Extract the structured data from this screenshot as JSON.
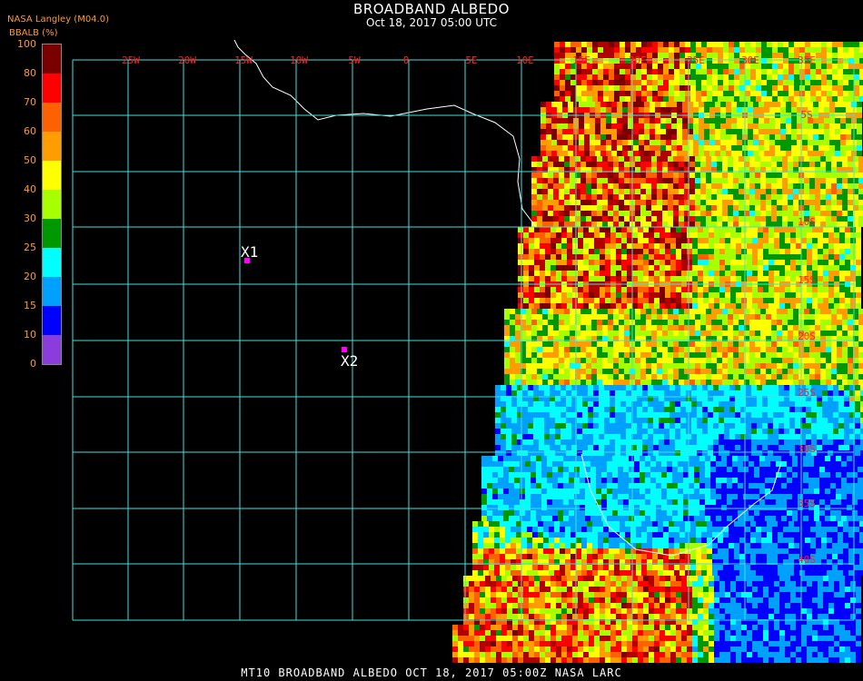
{
  "header": {
    "title": "BROADBAND ALBEDO",
    "subtitle": "Oct 18, 2017 05:00 UTC",
    "source": "NASA Langley (M04.0)",
    "units": "BBALB (%)"
  },
  "legend": {
    "ticks": [
      "100",
      "80",
      "70",
      "60",
      "50",
      "40",
      "30",
      "25",
      "20",
      "15",
      "10",
      "0"
    ],
    "colors": [
      "#7a0000",
      "#ff0000",
      "#ff6000",
      "#ff9c00",
      "#ffff00",
      "#a8ff00",
      "#009800",
      "#00ffff",
      "#00a0ff",
      "#0000ff",
      "#8a3cdc"
    ]
  },
  "grid": {
    "lon_labels": [
      "25W",
      "20W",
      "15W",
      "10W",
      "5W",
      "0",
      "5E",
      "10E",
      "15E",
      "20E",
      "25E",
      "30E",
      "35E"
    ],
    "lat_labels": [
      "5S",
      "10S",
      "15S",
      "20S",
      "25S",
      "30S",
      "35S",
      "40S"
    ],
    "line_color": "#40e0e0",
    "label_color": "#ff2020"
  },
  "markers": [
    {
      "label": "X1",
      "color": "#ff00ff"
    },
    {
      "label": "X2",
      "color": "#ff00ff"
    }
  ],
  "footer": "MT10  BROADBAND ALBEDO  OCT 18, 2017 05:00Z  NASA LARC"
}
